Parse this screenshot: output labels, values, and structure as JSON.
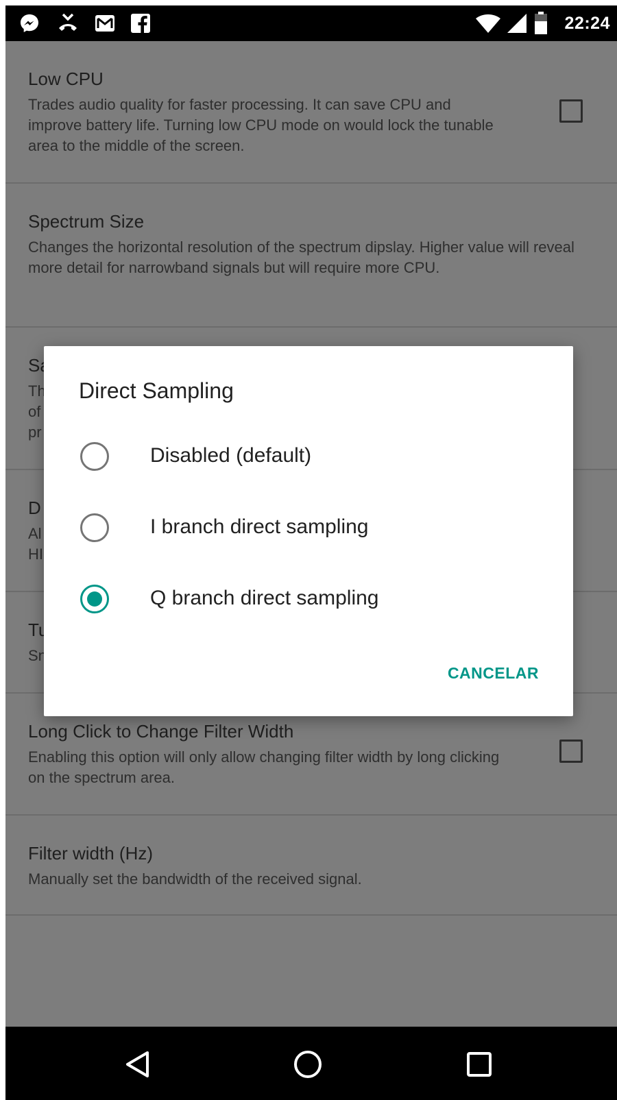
{
  "status_bar": {
    "time": "22:24",
    "left_icons": [
      "messenger-icon",
      "missed-call-icon",
      "gmail-icon",
      "facebook-icon"
    ],
    "right_icons": [
      "wifi-icon",
      "cell-signal-icon",
      "battery-icon"
    ]
  },
  "settings": [
    {
      "title": "Low CPU",
      "summary": "Trades audio quality for faster processing. It can save CPU and improve battery life. Turning low CPU mode on would lock the tunable area to the middle of the screen.",
      "has_checkbox": true
    },
    {
      "title": "Spectrum Size",
      "summary": "Changes the horizontal resolution of the spectrum dipslay. Higher value will reveal more detail for narrowband signals but will require more CPU.",
      "has_checkbox": false
    },
    {
      "title": "Sa",
      "summary_lines": [
        "Th",
        "of",
        "pr"
      ]
    },
    {
      "title": "D",
      "summary_lines": [
        "Al",
        "HI"
      ]
    },
    {
      "title": "Tu",
      "summary_lines": [
        "Sn"
      ]
    },
    {
      "title": "Long Click to Change Filter Width",
      "summary": "Enabling this option will only allow changing filter width by long clicking on the spectrum area.",
      "has_checkbox": true
    },
    {
      "title": "Filter width (Hz)",
      "summary": "Manually set the bandwidth of the received signal."
    }
  ],
  "dialog": {
    "title": "Direct Sampling",
    "options": [
      {
        "label": "Disabled (default)",
        "selected": false
      },
      {
        "label": "I branch direct sampling",
        "selected": false
      },
      {
        "label": "Q branch direct sampling",
        "selected": true
      }
    ],
    "cancel_label": "CANCELAR"
  },
  "nav_bar": {
    "buttons": [
      "back-icon",
      "home-icon",
      "recents-icon"
    ]
  },
  "colors": {
    "accent": "#009688",
    "scrim_background": "#7d7d7d",
    "status_bar": "#000000",
    "nav_bar": "#000000"
  }
}
